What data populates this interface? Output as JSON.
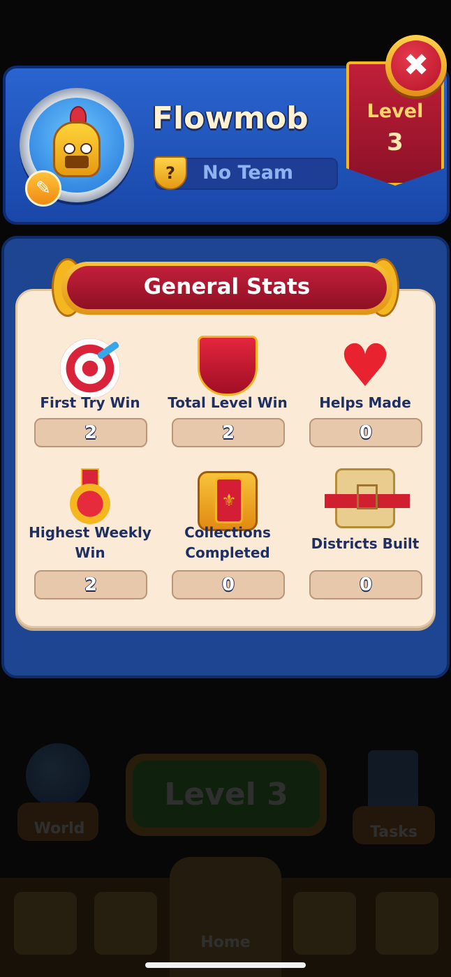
{
  "background": {
    "world_label": "World",
    "play_button_label": "Level 3",
    "tasks_label": "Tasks",
    "home_label": "Home"
  },
  "profile": {
    "player_name": "Flowmob",
    "team_icon_glyph": "?",
    "team_name": "No Team",
    "level_label": "Level",
    "level_value": "3",
    "close_glyph": "✖",
    "edit_glyph": "✎"
  },
  "stats": {
    "title": "General Stats",
    "items": [
      {
        "label": "First Try Win",
        "value": "2",
        "icon": "target-icon"
      },
      {
        "label": "Total Level Win",
        "value": "2",
        "icon": "trumpets-icon"
      },
      {
        "label": "Helps Made",
        "value": "0",
        "icon": "heart-icon"
      },
      {
        "label": "Highest Weekly Win",
        "value": "2",
        "icon": "medal-icon"
      },
      {
        "label": "Collections Completed",
        "value": "0",
        "icon": "cards-icon"
      },
      {
        "label": "Districts Built",
        "value": "0",
        "icon": "castle-scroll-icon"
      }
    ]
  },
  "colors": {
    "panel_blue": "#1e4592",
    "banner_red": "#c01f38",
    "gold": "#f4b720",
    "cream": "#fbead6"
  }
}
